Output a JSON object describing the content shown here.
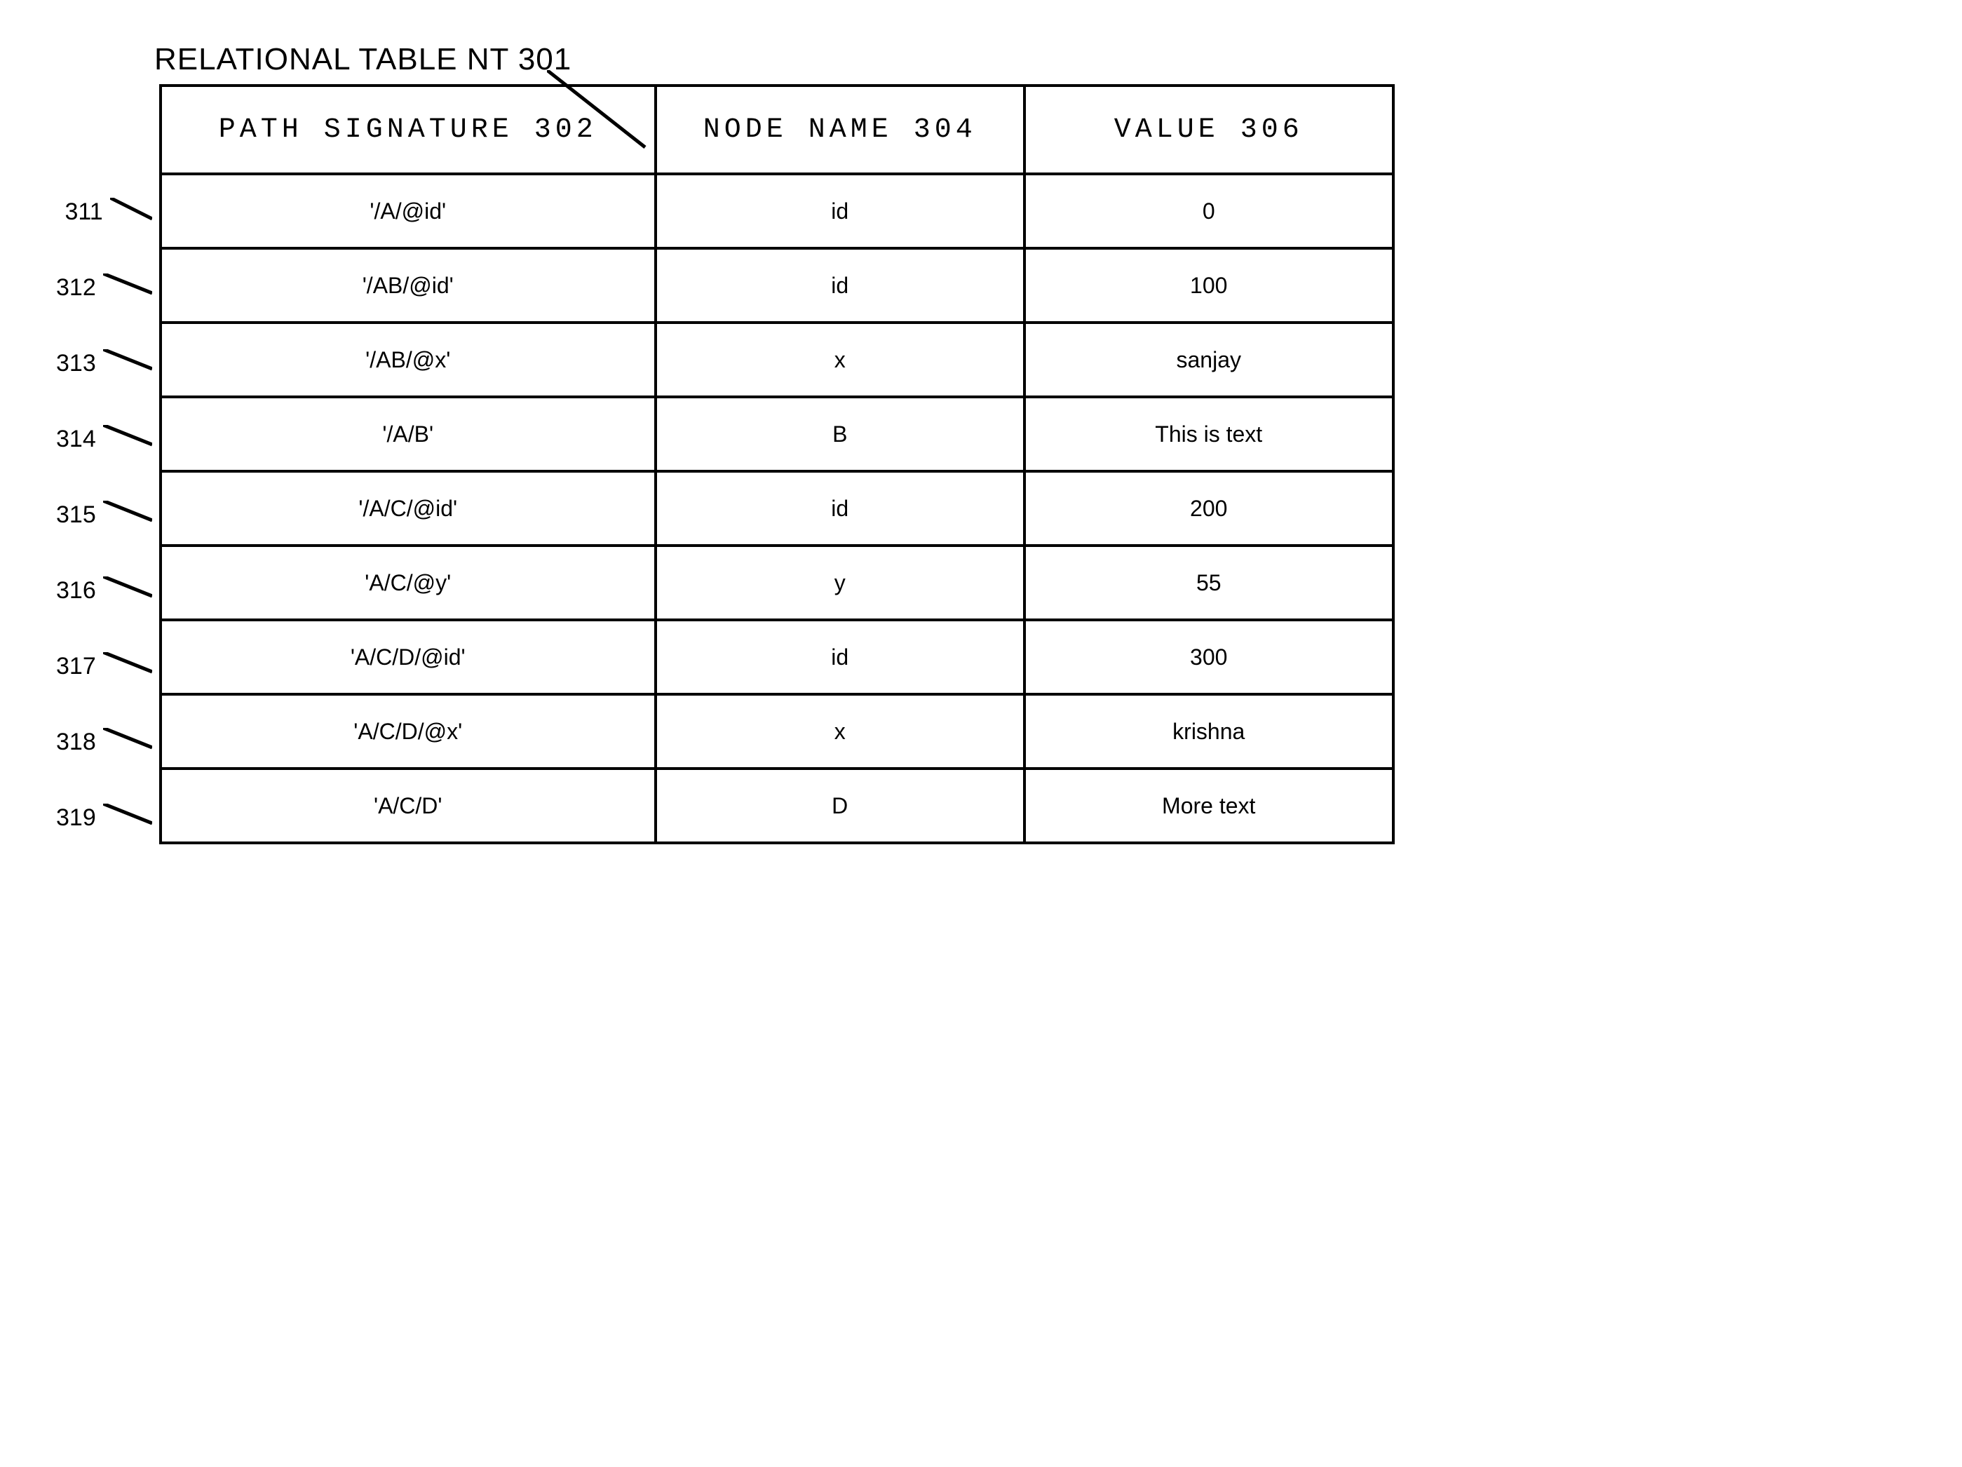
{
  "title": "RELATIONAL TABLE NT 301",
  "columns": {
    "path": "PATH SIGNATURE 302",
    "name": "NODE NAME 304",
    "value": "VALUE 306"
  },
  "row_labels": [
    "311",
    "312",
    "313",
    "314",
    "315",
    "316",
    "317",
    "318",
    "319"
  ],
  "rows": [
    {
      "path": "'/A/@id'",
      "name": "id",
      "value": "0"
    },
    {
      "path": "'/AB/@id'",
      "name": "id",
      "value": "100"
    },
    {
      "path": "'/AB/@x'",
      "name": "x",
      "value": "sanjay"
    },
    {
      "path": "'/A/B'",
      "name": "B",
      "value": "This is text"
    },
    {
      "path": "'/A/C/@id'",
      "name": "id",
      "value": "200"
    },
    {
      "path": "'A/C/@y'",
      "name": "y",
      "value": "55"
    },
    {
      "path": "'A/C/D/@id'",
      "name": "id",
      "value": "300"
    },
    {
      "path": "'A/C/D/@x'",
      "name": "x",
      "value": "krishna"
    },
    {
      "path": "'A/C/D'",
      "name": "D",
      "value": "More text"
    }
  ]
}
